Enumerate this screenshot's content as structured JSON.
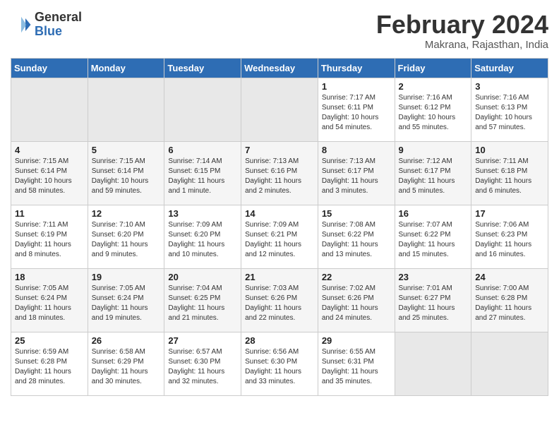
{
  "header": {
    "logo_general": "General",
    "logo_blue": "Blue",
    "month_title": "February 2024",
    "location": "Makrana, Rajasthan, India"
  },
  "days_of_week": [
    "Sunday",
    "Monday",
    "Tuesday",
    "Wednesday",
    "Thursday",
    "Friday",
    "Saturday"
  ],
  "weeks": [
    [
      {
        "day": "",
        "empty": true
      },
      {
        "day": "",
        "empty": true
      },
      {
        "day": "",
        "empty": true
      },
      {
        "day": "",
        "empty": true
      },
      {
        "day": "1",
        "sunrise": "7:17 AM",
        "sunset": "6:11 PM",
        "daylight": "10 hours and 54 minutes."
      },
      {
        "day": "2",
        "sunrise": "7:16 AM",
        "sunset": "6:12 PM",
        "daylight": "10 hours and 55 minutes."
      },
      {
        "day": "3",
        "sunrise": "7:16 AM",
        "sunset": "6:13 PM",
        "daylight": "10 hours and 57 minutes."
      }
    ],
    [
      {
        "day": "4",
        "sunrise": "7:15 AM",
        "sunset": "6:14 PM",
        "daylight": "10 hours and 58 minutes."
      },
      {
        "day": "5",
        "sunrise": "7:15 AM",
        "sunset": "6:14 PM",
        "daylight": "10 hours and 59 minutes."
      },
      {
        "day": "6",
        "sunrise": "7:14 AM",
        "sunset": "6:15 PM",
        "daylight": "11 hours and 1 minute."
      },
      {
        "day": "7",
        "sunrise": "7:13 AM",
        "sunset": "6:16 PM",
        "daylight": "11 hours and 2 minutes."
      },
      {
        "day": "8",
        "sunrise": "7:13 AM",
        "sunset": "6:17 PM",
        "daylight": "11 hours and 3 minutes."
      },
      {
        "day": "9",
        "sunrise": "7:12 AM",
        "sunset": "6:17 PM",
        "daylight": "11 hours and 5 minutes."
      },
      {
        "day": "10",
        "sunrise": "7:11 AM",
        "sunset": "6:18 PM",
        "daylight": "11 hours and 6 minutes."
      }
    ],
    [
      {
        "day": "11",
        "sunrise": "7:11 AM",
        "sunset": "6:19 PM",
        "daylight": "11 hours and 8 minutes."
      },
      {
        "day": "12",
        "sunrise": "7:10 AM",
        "sunset": "6:20 PM",
        "daylight": "11 hours and 9 minutes."
      },
      {
        "day": "13",
        "sunrise": "7:09 AM",
        "sunset": "6:20 PM",
        "daylight": "11 hours and 10 minutes."
      },
      {
        "day": "14",
        "sunrise": "7:09 AM",
        "sunset": "6:21 PM",
        "daylight": "11 hours and 12 minutes."
      },
      {
        "day": "15",
        "sunrise": "7:08 AM",
        "sunset": "6:22 PM",
        "daylight": "11 hours and 13 minutes."
      },
      {
        "day": "16",
        "sunrise": "7:07 AM",
        "sunset": "6:22 PM",
        "daylight": "11 hours and 15 minutes."
      },
      {
        "day": "17",
        "sunrise": "7:06 AM",
        "sunset": "6:23 PM",
        "daylight": "11 hours and 16 minutes."
      }
    ],
    [
      {
        "day": "18",
        "sunrise": "7:05 AM",
        "sunset": "6:24 PM",
        "daylight": "11 hours and 18 minutes."
      },
      {
        "day": "19",
        "sunrise": "7:05 AM",
        "sunset": "6:24 PM",
        "daylight": "11 hours and 19 minutes."
      },
      {
        "day": "20",
        "sunrise": "7:04 AM",
        "sunset": "6:25 PM",
        "daylight": "11 hours and 21 minutes."
      },
      {
        "day": "21",
        "sunrise": "7:03 AM",
        "sunset": "6:26 PM",
        "daylight": "11 hours and 22 minutes."
      },
      {
        "day": "22",
        "sunrise": "7:02 AM",
        "sunset": "6:26 PM",
        "daylight": "11 hours and 24 minutes."
      },
      {
        "day": "23",
        "sunrise": "7:01 AM",
        "sunset": "6:27 PM",
        "daylight": "11 hours and 25 minutes."
      },
      {
        "day": "24",
        "sunrise": "7:00 AM",
        "sunset": "6:28 PM",
        "daylight": "11 hours and 27 minutes."
      }
    ],
    [
      {
        "day": "25",
        "sunrise": "6:59 AM",
        "sunset": "6:28 PM",
        "daylight": "11 hours and 28 minutes."
      },
      {
        "day": "26",
        "sunrise": "6:58 AM",
        "sunset": "6:29 PM",
        "daylight": "11 hours and 30 minutes."
      },
      {
        "day": "27",
        "sunrise": "6:57 AM",
        "sunset": "6:30 PM",
        "daylight": "11 hours and 32 minutes."
      },
      {
        "day": "28",
        "sunrise": "6:56 AM",
        "sunset": "6:30 PM",
        "daylight": "11 hours and 33 minutes."
      },
      {
        "day": "29",
        "sunrise": "6:55 AM",
        "sunset": "6:31 PM",
        "daylight": "11 hours and 35 minutes."
      },
      {
        "day": "",
        "empty": true
      },
      {
        "day": "",
        "empty": true
      }
    ]
  ]
}
